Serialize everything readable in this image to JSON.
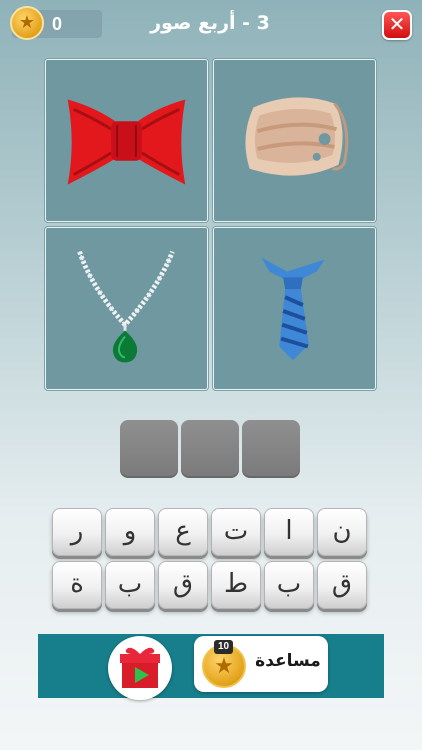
{
  "header": {
    "coins": "0",
    "level_title": "3 - أربع صور",
    "close_label": "✕"
  },
  "pictures": [
    {
      "name": "neck-brace"
    },
    {
      "name": "bow-tie"
    },
    {
      "name": "necktie"
    },
    {
      "name": "necklace"
    }
  ],
  "answer": {
    "slots": 3
  },
  "keyboard": {
    "row1": [
      "ن",
      "ا",
      "ت",
      "ع",
      "و",
      "ر"
    ],
    "row2": [
      "ق",
      "ب",
      "ط",
      "ق",
      "ب",
      "ة"
    ]
  },
  "bottom": {
    "help_label": "مساعدة",
    "help_cost": "10"
  },
  "colors": {
    "tile": "#6f98a0",
    "bar": "#177e8c",
    "close": "#e01818",
    "coin": "#e3a21a"
  }
}
